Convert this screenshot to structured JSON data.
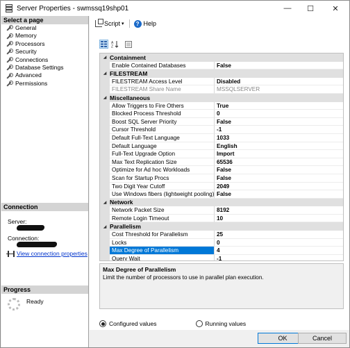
{
  "window": {
    "title": "Server Properties - swmssq19shp01",
    "min_glyph": "—",
    "max_glyph": "☐",
    "close_glyph": "✕"
  },
  "left": {
    "select_page_header": "Select a page",
    "pages": [
      "General",
      "Memory",
      "Processors",
      "Security",
      "Connections",
      "Database Settings",
      "Advanced",
      "Permissions"
    ],
    "connection_header": "Connection",
    "server_label": "Server:",
    "connection_label": "Connection:",
    "view_link": "View connection properties",
    "progress_header": "Progress",
    "progress_status": "Ready"
  },
  "toolbar": {
    "script_label": "Script",
    "script_caret": "▾",
    "help_label": "Help"
  },
  "grid": {
    "categories": [
      {
        "name": "Containment",
        "rows": [
          {
            "name": "Enable Contained Databases",
            "value": "False"
          }
        ]
      },
      {
        "name": "FILESTREAM",
        "rows": [
          {
            "name": "FILESTREAM Access Level",
            "value": "Disabled"
          },
          {
            "name": "FILESTREAM Share Name",
            "value": "MSSQLSERVER",
            "disabled": true
          }
        ]
      },
      {
        "name": "Miscellaneous",
        "rows": [
          {
            "name": "Allow Triggers to Fire Others",
            "value": "True"
          },
          {
            "name": "Blocked Process Threshold",
            "value": "0"
          },
          {
            "name": "Boost SQL Server Priority",
            "value": "False"
          },
          {
            "name": "Cursor Threshold",
            "value": "-1"
          },
          {
            "name": "Default Full-Text Language",
            "value": "1033"
          },
          {
            "name": "Default Language",
            "value": "English"
          },
          {
            "name": "Full-Text Upgrade Option",
            "value": "Import"
          },
          {
            "name": "Max Text Replication Size",
            "value": "65536"
          },
          {
            "name": "Optimize for Ad hoc Workloads",
            "value": "False"
          },
          {
            "name": "Scan for Startup Procs",
            "value": "False"
          },
          {
            "name": "Two Digit Year Cutoff",
            "value": "2049"
          },
          {
            "name": "Use Windows fibers (lightweight pooling)",
            "value": "False"
          }
        ]
      },
      {
        "name": "Network",
        "rows": [
          {
            "name": "Network Packet Size",
            "value": "8192"
          },
          {
            "name": "Remote Login Timeout",
            "value": "10"
          }
        ]
      },
      {
        "name": "Parallelism",
        "rows": [
          {
            "name": "Cost Threshold for Parallelism",
            "value": "25"
          },
          {
            "name": "Locks",
            "value": "0"
          },
          {
            "name": "Max Degree of Parallelism",
            "value": "4",
            "selected": true
          },
          {
            "name": "Query Wait",
            "value": "-1"
          }
        ]
      }
    ]
  },
  "description": {
    "title": "Max Degree of Parallelism",
    "text": "Limit the number of processors to use in parallel plan execution."
  },
  "radios": {
    "configured_label": "Configured values",
    "running_label": "Running values",
    "selected": "configured"
  },
  "buttons": {
    "ok_label": "OK",
    "cancel_label": "Cancel"
  },
  "colors": {
    "selection": "#0078d7",
    "link": "#0033cc",
    "category_bg": "#e0e0e0"
  }
}
